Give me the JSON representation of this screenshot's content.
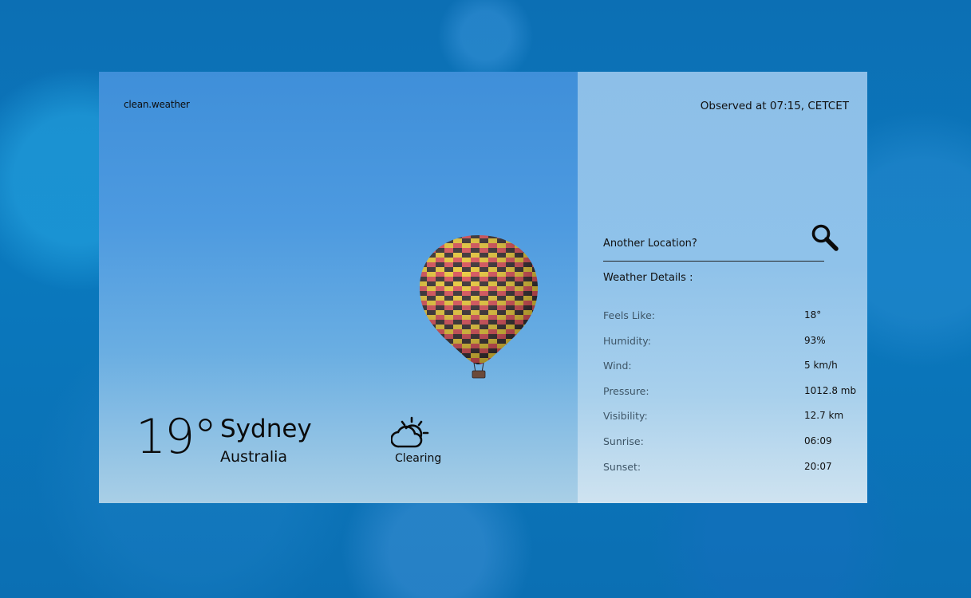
{
  "app": {
    "brand": "clean.weather"
  },
  "observation": {
    "text": "Observed at 07:15, CETCET"
  },
  "current": {
    "temperature": "19°",
    "city": "Sydney",
    "country": "Australia",
    "condition": "Clearing",
    "condition_icon": "cloud-sun-icon"
  },
  "search": {
    "label": "Another Location?",
    "icon": "search-icon"
  },
  "details": {
    "title": "Weather Details :",
    "rows": [
      {
        "label": "Feels Like:",
        "value": "18°"
      },
      {
        "label": "Humidity:",
        "value": "93%"
      },
      {
        "label": "Wind:",
        "value": "5 km/h"
      },
      {
        "label": "Pressure:",
        "value": "1012.8 mb"
      },
      {
        "label": "Visibility:",
        "value": "12.7 km"
      },
      {
        "label": "Sunrise:",
        "value": "06:09"
      },
      {
        "label": "Sunset:",
        "value": "20:07"
      }
    ]
  },
  "colors": {
    "background": "#0b74b9",
    "sky_top": "#3f8fd9",
    "panel": "#8fc2ea",
    "balloon_yellow": "#e8c52e",
    "balloon_red": "#d8474f",
    "balloon_dark": "#2c2326"
  }
}
